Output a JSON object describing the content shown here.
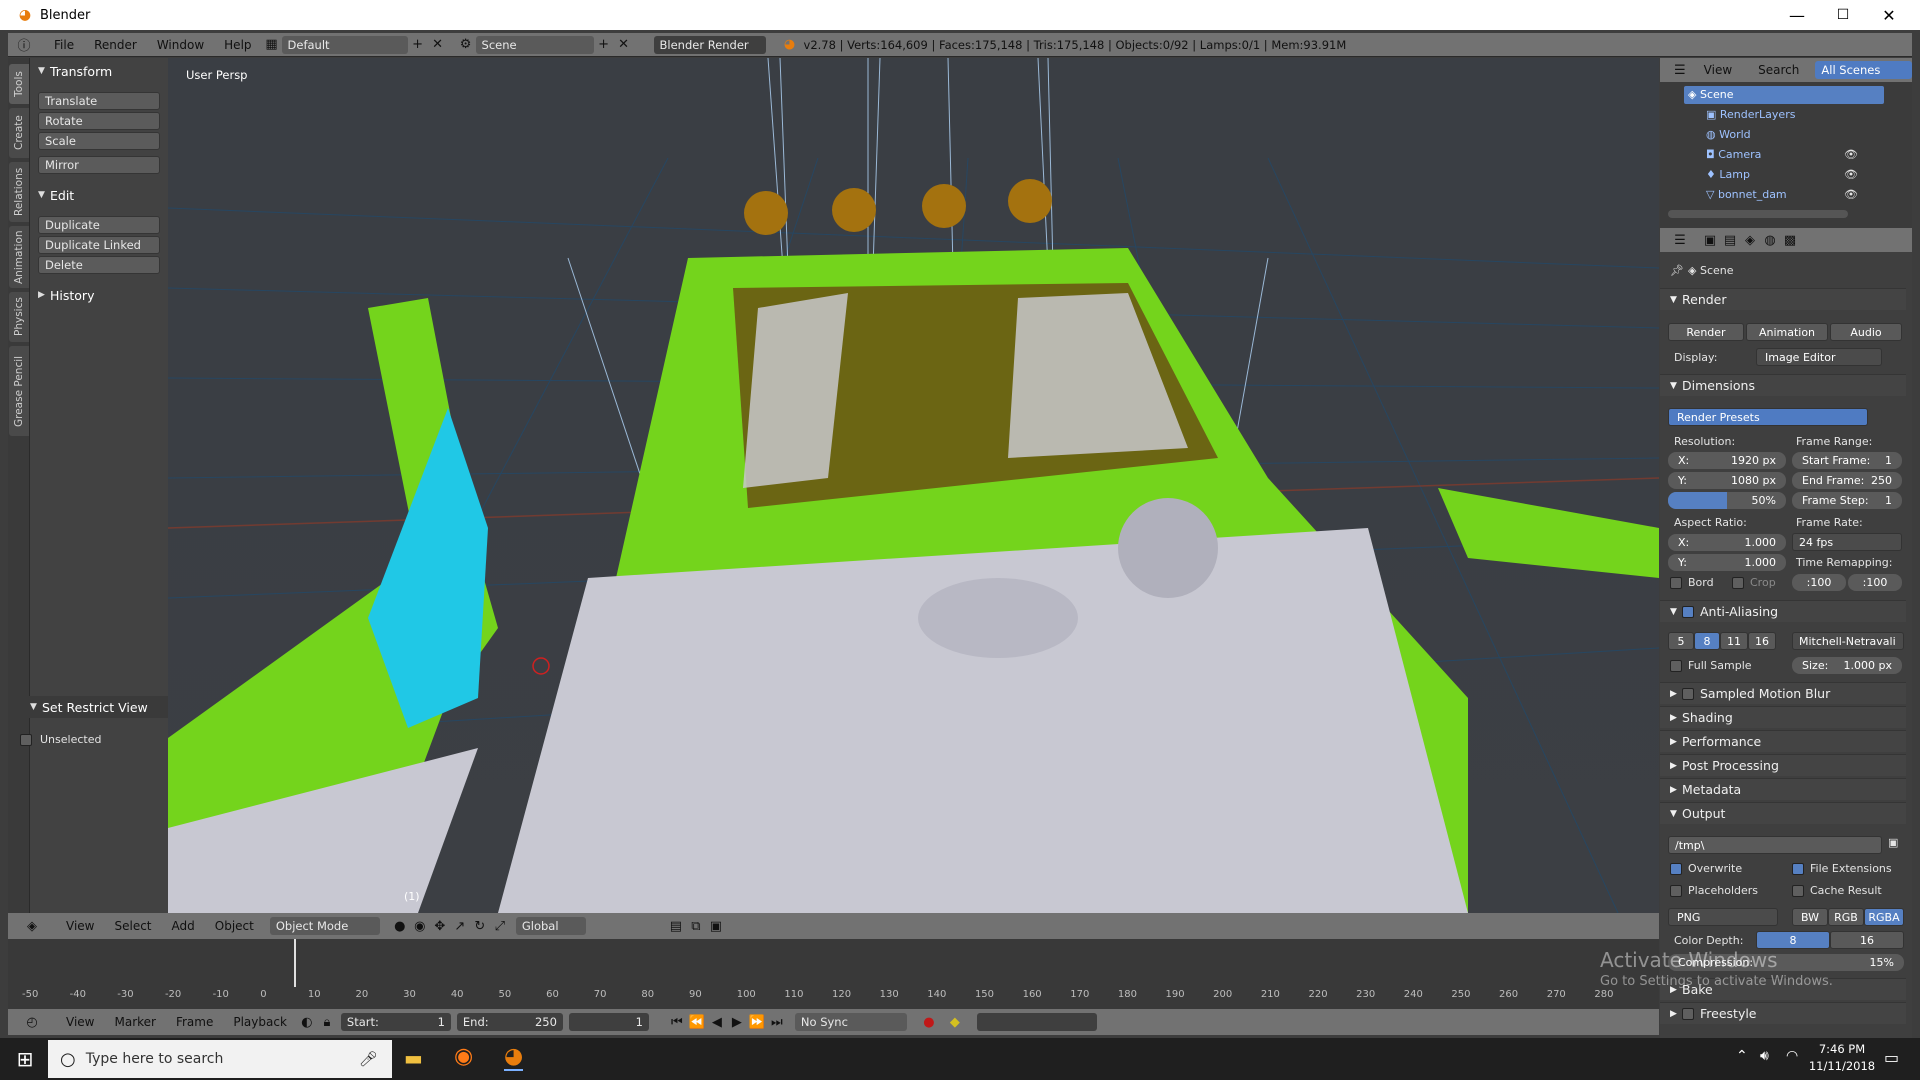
{
  "window": {
    "title": "Blender",
    "minimize": "—",
    "maximize": "☐",
    "close": "✕"
  },
  "topbar": {
    "menus": [
      "File",
      "Render",
      "Window",
      "Help"
    ],
    "screen_layout": "Default",
    "scene": "Scene",
    "engine": "Blender Render",
    "stats": "v2.78 | Verts:164,609 | Faces:175,148 | Tris:175,148 | Objects:0/92 | Lamps:0/1 | Mem:93.91M"
  },
  "tabs": [
    "Tools",
    "Create",
    "Relations",
    "Animation",
    "Physics",
    "Grease Pencil"
  ],
  "toolshelf": {
    "transform": {
      "title": "Transform",
      "buttons": [
        "Translate",
        "Rotate",
        "Scale",
        "Mirror"
      ]
    },
    "edit": {
      "title": "Edit",
      "buttons": [
        "Duplicate",
        "Duplicate Linked",
        "Delete"
      ]
    },
    "history": {
      "title": "History"
    },
    "restrict": {
      "title": "Set Restrict View",
      "option": "Unselected"
    }
  },
  "viewport": {
    "label": "User Persp",
    "mark": "(1)"
  },
  "vpheader": {
    "menus": [
      "View",
      "Select",
      "Add",
      "Object"
    ],
    "mode": "Object Mode",
    "orientation": "Global"
  },
  "timeline": {
    "ticks": [
      "-50",
      "-40",
      "-30",
      "-20",
      "-10",
      "0",
      "10",
      "20",
      "30",
      "40",
      "50",
      "60",
      "70",
      "80",
      "90",
      "100",
      "110",
      "120",
      "130",
      "140",
      "150",
      "160",
      "170",
      "180",
      "190",
      "200",
      "210",
      "220",
      "230",
      "240",
      "250",
      "260",
      "270",
      "280"
    ],
    "menus": [
      "View",
      "Marker",
      "Frame",
      "Playback"
    ],
    "start_label": "Start:",
    "start": "1",
    "end_label": "End:",
    "end": "250",
    "current": "1",
    "sync": "No Sync"
  },
  "outliner": {
    "menus": [
      "View",
      "Search"
    ],
    "filter": "All Scenes",
    "items": [
      "Scene",
      "RenderLayers",
      "World",
      "Camera",
      "Lamp",
      "bonnet_dam"
    ]
  },
  "props": {
    "context": "Scene",
    "render": {
      "title": "Render",
      "buttons": [
        "Render",
        "Animation",
        "Audio"
      ],
      "display_label": "Display:",
      "display": "Image Editor"
    },
    "dimensions": {
      "title": "Dimensions",
      "presets": "Render Presets",
      "resolution_label": "Resolution:",
      "res_x": "1920 px",
      "res_y": "1080 px",
      "res_pct": "50%",
      "res_pct_value": 0.5,
      "frame_range_label": "Frame Range:",
      "start_frame": "Start Frame:",
      "start_frame_value": "1",
      "end_frame": "End Frame:",
      "end_frame_value": "250",
      "frame_step": "Frame Step:",
      "frame_step_value": "1",
      "aspect_label": "Aspect Ratio:",
      "asp_x": "1.000",
      "asp_y": "1.000",
      "frame_rate_label": "Frame Rate:",
      "fps": "24 fps",
      "time_remap_label": "Time Remapping:",
      "remap_old": ":100",
      "remap_new": ":100",
      "bord": "Bord",
      "crop": "Crop",
      "x": "X:",
      "y": "Y:"
    },
    "aa": {
      "title": "Anti-Aliasing",
      "samples": [
        "5",
        "8",
        "11",
        "16"
      ],
      "filter": "Mitchell-Netravali",
      "full_sample": "Full Sample",
      "size_label": "Size:",
      "size": "1.000 px"
    },
    "sections": [
      "Sampled Motion Blur",
      "Shading",
      "Performance",
      "Post Processing",
      "Metadata"
    ],
    "output": {
      "title": "Output",
      "path": "/tmp\\",
      "overwrite": "Overwrite",
      "file_ext": "File Extensions",
      "placeholders": "Placeholders",
      "cache": "Cache Result",
      "format": "PNG",
      "modes": [
        "BW",
        "RGB",
        "RGBA"
      ],
      "depth_label": "Color Depth:",
      "depths": [
        "8",
        "16"
      ],
      "compression_label": "Compression:",
      "compression": "15%"
    },
    "bake": "Bake",
    "freestyle": "Freestyle"
  },
  "watermark": {
    "line1": "Activate Windows",
    "line2": "Go to Settings to activate Windows."
  },
  "taskbar": {
    "search_placeholder": "Type here to search",
    "time": "7:46 PM",
    "date": "11/11/2018"
  }
}
